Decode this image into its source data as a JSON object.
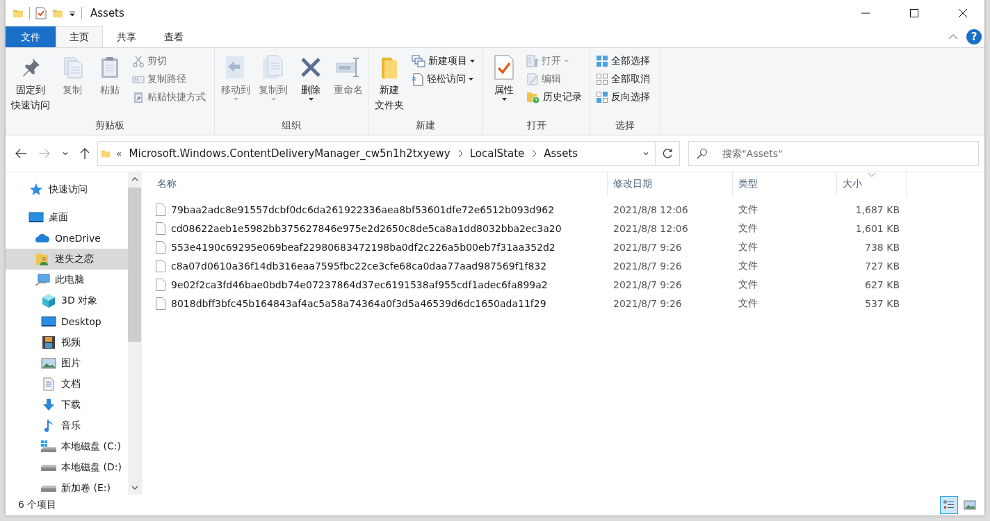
{
  "window": {
    "title": "Assets"
  },
  "ribbon_tabs": [
    {
      "label": "文件",
      "kind": "file",
      "selected": false
    },
    {
      "label": "主页",
      "kind": "tab",
      "selected": true
    },
    {
      "label": "共享",
      "kind": "tab",
      "selected": false
    },
    {
      "label": "查看",
      "kind": "tab",
      "selected": false
    }
  ],
  "help_label": "?",
  "ribbon_groups": [
    {
      "label": "剪贴板",
      "commands": [
        {
          "lines": [
            "固定到",
            "快速访问"
          ],
          "kind": "large",
          "disabled": false,
          "dropdown": false
        },
        {
          "lines": [
            "复制"
          ],
          "kind": "large",
          "disabled": true,
          "dropdown": false
        },
        {
          "lines": [
            "粘贴"
          ],
          "kind": "large",
          "disabled": true,
          "dropdown": false
        },
        {
          "lines": [
            "剪切"
          ],
          "kind": "small",
          "disabled": true,
          "dropdown": false
        },
        {
          "lines": [
            "复制路径"
          ],
          "kind": "small",
          "disabled": true,
          "dropdown": false
        },
        {
          "lines": [
            "粘贴快捷方式"
          ],
          "kind": "small",
          "disabled": true,
          "dropdown": false
        }
      ]
    },
    {
      "label": "组织",
      "commands": [
        {
          "lines": [
            "移动到"
          ],
          "kind": "large",
          "disabled": true,
          "dropdown": true
        },
        {
          "lines": [
            "复制到"
          ],
          "kind": "large",
          "disabled": true,
          "dropdown": true
        },
        {
          "lines": [
            "删除"
          ],
          "kind": "large",
          "disabled": false,
          "dropdown": true
        },
        {
          "lines": [
            "重命名"
          ],
          "kind": "large",
          "disabled": true,
          "dropdown": false
        }
      ]
    },
    {
      "label": "新建",
      "commands": [
        {
          "lines": [
            "新建",
            "文件夹"
          ],
          "kind": "large",
          "disabled": false,
          "dropdown": false
        },
        {
          "lines": [
            "新建项目"
          ],
          "kind": "small",
          "disabled": false,
          "dropdown": true
        },
        {
          "lines": [
            "轻松访问"
          ],
          "kind": "small",
          "disabled": false,
          "dropdown": true
        }
      ]
    },
    {
      "label": "打开",
      "commands": [
        {
          "lines": [
            "属性"
          ],
          "kind": "large",
          "disabled": false,
          "dropdown": true
        },
        {
          "lines": [
            "打开"
          ],
          "kind": "small",
          "disabled": true,
          "dropdown": true
        },
        {
          "lines": [
            "编辑"
          ],
          "kind": "small",
          "disabled": true,
          "dropdown": false
        },
        {
          "lines": [
            "历史记录"
          ],
          "kind": "small",
          "disabled": false,
          "dropdown": false
        }
      ]
    },
    {
      "label": "选择",
      "commands": [
        {
          "lines": [
            "全部选择"
          ],
          "kind": "small",
          "disabled": false,
          "dropdown": false
        },
        {
          "lines": [
            "全部取消"
          ],
          "kind": "small",
          "disabled": false,
          "dropdown": false
        },
        {
          "lines": [
            "反向选择"
          ],
          "kind": "small",
          "disabled": false,
          "dropdown": false
        }
      ]
    }
  ],
  "address": {
    "overflow_mark": "«",
    "segments": [
      "Microsoft.Windows.ContentDeliveryManager_cw5n1h2txyewy",
      "LocalState",
      "Assets"
    ]
  },
  "search": {
    "placeholder": "搜索\"Assets\""
  },
  "nav_tree": [
    {
      "label": "快速访问",
      "selected": false
    },
    {
      "label": "桌面",
      "selected": false,
      "children": [
        {
          "label": "OneDrive",
          "selected": false
        },
        {
          "label": "迷失之恋",
          "selected": true
        },
        {
          "label": "此电脑",
          "selected": false,
          "children": [
            {
              "label": "3D 对象",
              "selected": false
            },
            {
              "label": "Desktop",
              "selected": false
            },
            {
              "label": "视频",
              "selected": false
            },
            {
              "label": "图片",
              "selected": false
            },
            {
              "label": "文档",
              "selected": false
            },
            {
              "label": "下载",
              "selected": false
            },
            {
              "label": "音乐",
              "selected": false
            },
            {
              "label": "本地磁盘 (C:)",
              "selected": false
            },
            {
              "label": "本地磁盘 (D:)",
              "selected": false
            },
            {
              "label": "新加卷 (E:)",
              "selected": false
            }
          ]
        }
      ]
    }
  ],
  "file_list": {
    "columns": [
      {
        "label": "名称",
        "sorted": false
      },
      {
        "label": "修改日期",
        "sorted": false
      },
      {
        "label": "类型",
        "sorted": false
      },
      {
        "label": "大小",
        "sorted": true
      }
    ],
    "rows": [
      {
        "name": "79baa2adc8e91557dcbf0dc6da261922336aea8bf53601dfe72e6512b093d962",
        "modified": "2021/8/8 12:06",
        "type": "文件",
        "size": "1,687 KB"
      },
      {
        "name": "cd08622aeb1e5982bb375627846e975e2d2650c8de5ca8a1dd8032bba2ec3a20",
        "modified": "2021/8/8 12:06",
        "type": "文件",
        "size": "1,601 KB"
      },
      {
        "name": "553e4190c69295e069beaf22980683472198ba0df2c226a5b00eb7f31aa352d2",
        "modified": "2021/8/7 9:26",
        "type": "文件",
        "size": "738 KB"
      },
      {
        "name": "c8a07d0610a36f14db316eaa7595fbc22ce3cfe68ca0daa77aad987569f1f832",
        "modified": "2021/8/7 9:26",
        "type": "文件",
        "size": "727 KB"
      },
      {
        "name": "9e02f2ca3fd46bae0bdb74e07237864d37ec6191538af955cdf1adec6fa899a2",
        "modified": "2021/8/7 9:26",
        "type": "文件",
        "size": "627 KB"
      },
      {
        "name": "8018dbff3bfc45b164843af4ac5a58a74364a0f3d5a46539d6dc1650ada11f29",
        "modified": "2021/8/7 9:26",
        "type": "文件",
        "size": "537 KB"
      }
    ]
  },
  "status_bar": {
    "item_count": "6 个项目",
    "view_buttons": [
      {
        "selected": true
      },
      {
        "selected": false
      }
    ]
  }
}
